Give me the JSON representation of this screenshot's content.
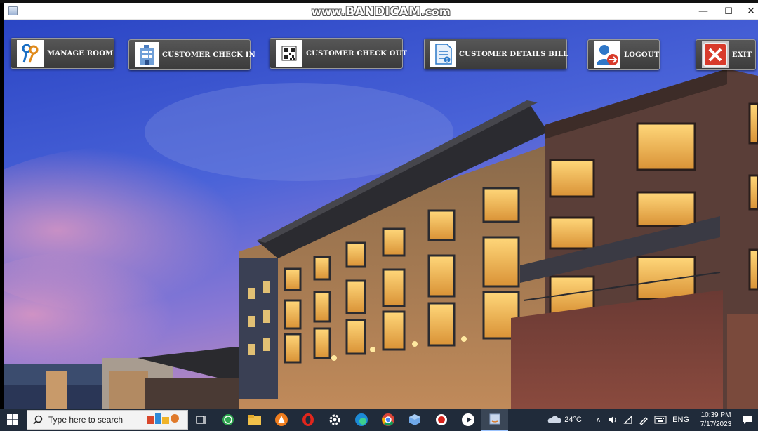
{
  "watermark": {
    "prefix": "www.",
    "brand": "BANDICAM",
    "suffix": ".com"
  },
  "window_controls": {
    "minimize": "—",
    "maximize": "☐",
    "close": "✕"
  },
  "toolbar": {
    "manage_room": "MANAGE ROOM",
    "check_in": "CUSTOMER CHECK IN",
    "check_out": "CUSTOMER CHECK OUT",
    "details_bill": "CUSTOMER DETAILS BILL",
    "logout": "LOGOUT",
    "exit": "EXIT"
  },
  "taskbar": {
    "search_placeholder": "Type here to search",
    "weather": "24°C",
    "language": "ENG",
    "time": "10:39 PM",
    "date": "7/17/2023"
  },
  "colors": {
    "sky_top": "#2e4fcf",
    "sky_bottom": "#8f7bd8",
    "window_glow": "#f6c35a",
    "taskbar": "#202b3a",
    "exit_red": "#d83b2b"
  }
}
